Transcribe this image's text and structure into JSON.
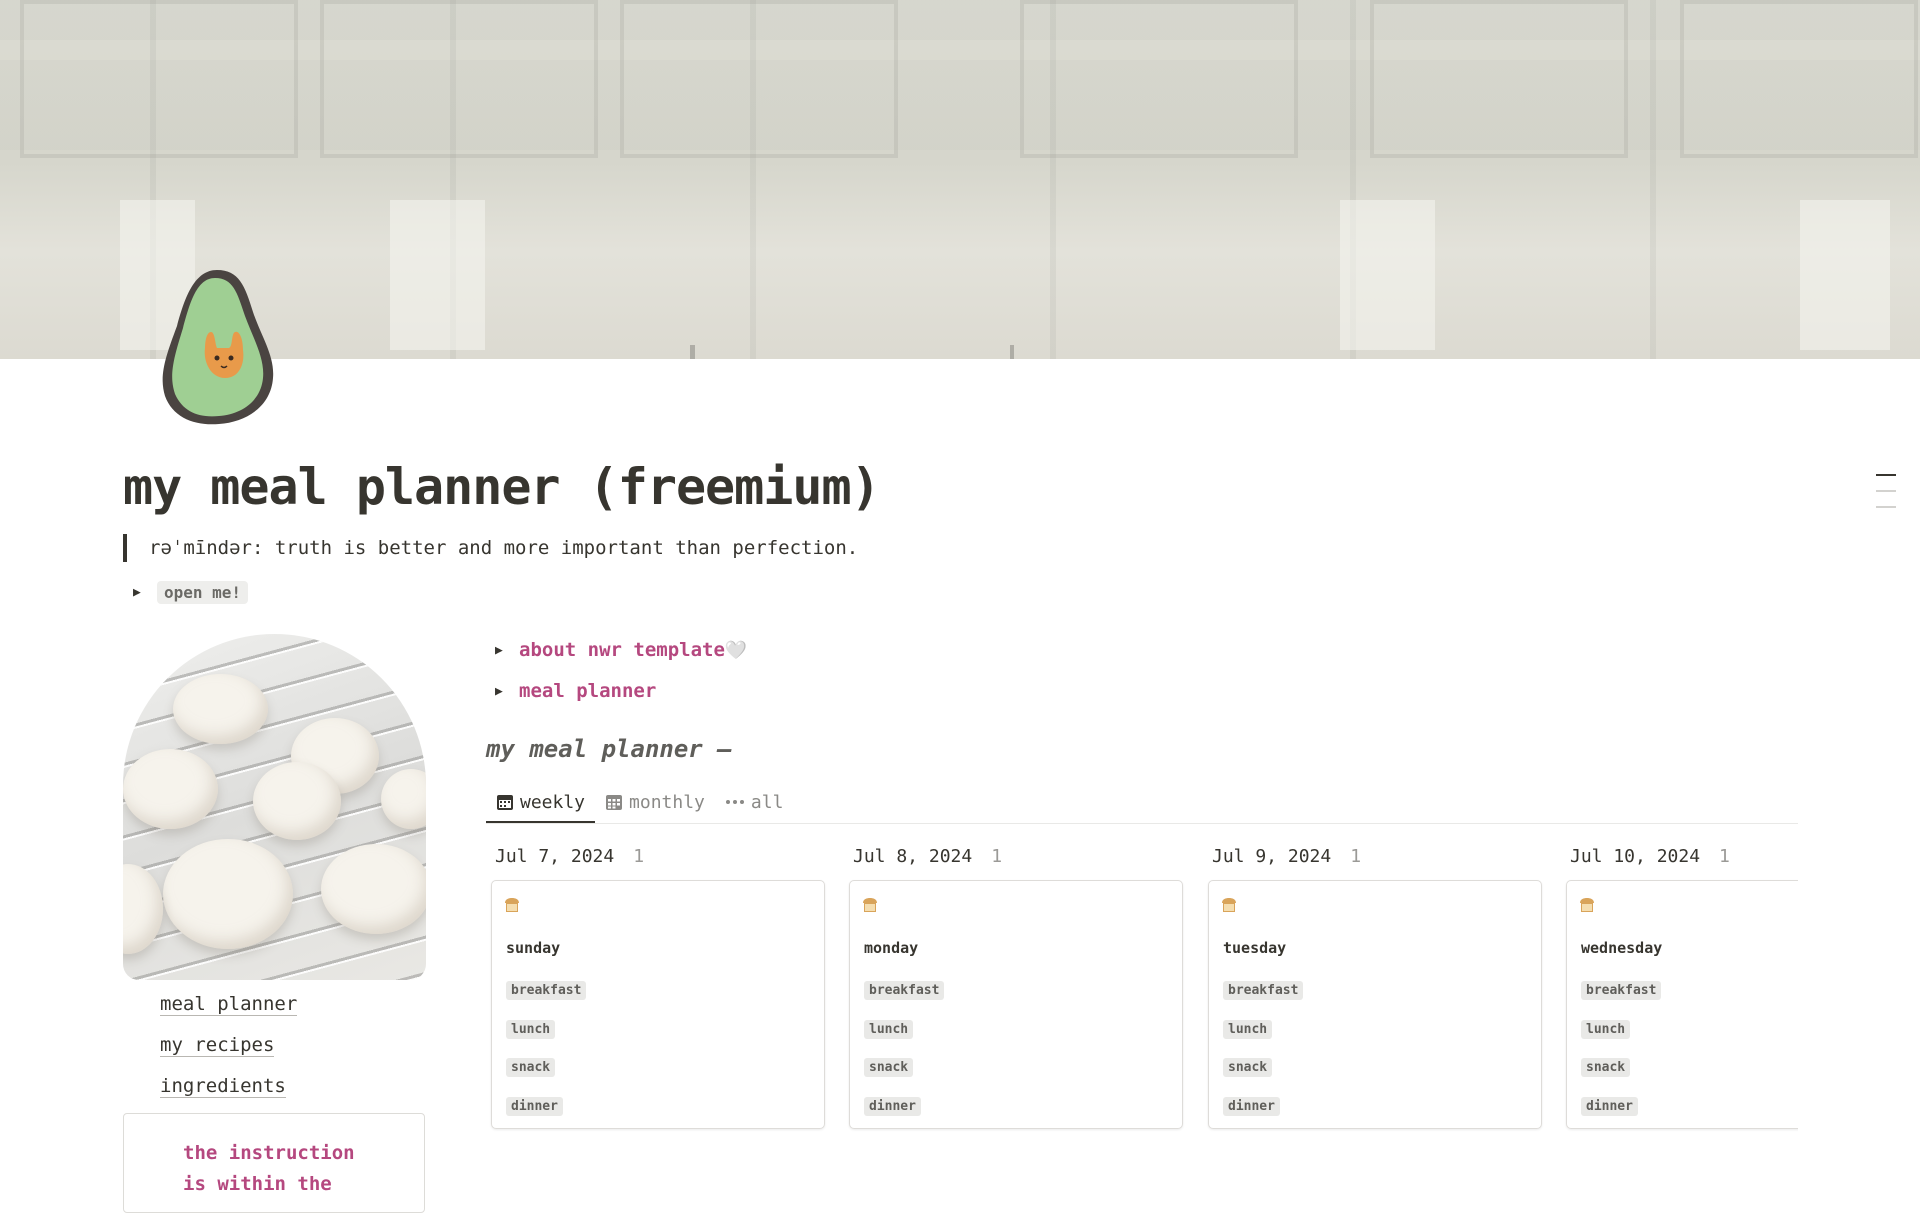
{
  "page": {
    "title": "my meal planner (freemium)",
    "quote": "rəˈmīndər: truth is better and more important than perfection.",
    "open_toggle_label": "open me!"
  },
  "toggles": [
    {
      "label": "about nwr template",
      "suffix": "🤍"
    },
    {
      "label": "meal planner"
    }
  ],
  "sidebar": {
    "links": [
      "meal planner",
      "my recipes",
      "ingredients"
    ],
    "callout_line1": "the instruction",
    "callout_line2": "is within the"
  },
  "database": {
    "title": "my meal planner —",
    "tabs": [
      {
        "label": "weekly",
        "icon": "calendar-icon",
        "active": true
      },
      {
        "label": "monthly",
        "icon": "grid-calendar-icon",
        "active": false
      },
      {
        "label": "all",
        "icon": "more-dots-icon",
        "active": false
      }
    ],
    "columns": [
      {
        "date": "Jul 7, 2024",
        "count": "1",
        "card_title": "sunday",
        "tags": [
          "breakfast",
          "lunch",
          "snack",
          "dinner"
        ]
      },
      {
        "date": "Jul 8, 2024",
        "count": "1",
        "card_title": "monday",
        "tags": [
          "breakfast",
          "lunch",
          "snack",
          "dinner"
        ]
      },
      {
        "date": "Jul 9, 2024",
        "count": "1",
        "card_title": "tuesday",
        "tags": [
          "breakfast",
          "lunch",
          "snack",
          "dinner"
        ]
      },
      {
        "date": "Jul 10, 2024",
        "count": "1",
        "card_title": "wednesday",
        "tags": [
          "breakfast",
          "lunch",
          "snack",
          "dinner"
        ]
      }
    ]
  },
  "colors": {
    "text": "#37352f",
    "accent_pink": "#b5487f",
    "tag_bg": "#e9e9e7"
  }
}
